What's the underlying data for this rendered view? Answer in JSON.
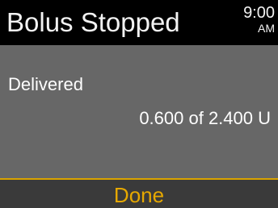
{
  "header": {
    "title": "Bolus Stopped",
    "time": "9:00",
    "ampm": "AM"
  },
  "main": {
    "label": "Delivered",
    "value": "0.600 of 2.400 U"
  },
  "softkey": {
    "label": "Done"
  },
  "colors": {
    "header_bg": "#000000",
    "panel_bg": "#676767",
    "softkey_bg": "#3a3a3a",
    "accent": "#e6a800"
  }
}
